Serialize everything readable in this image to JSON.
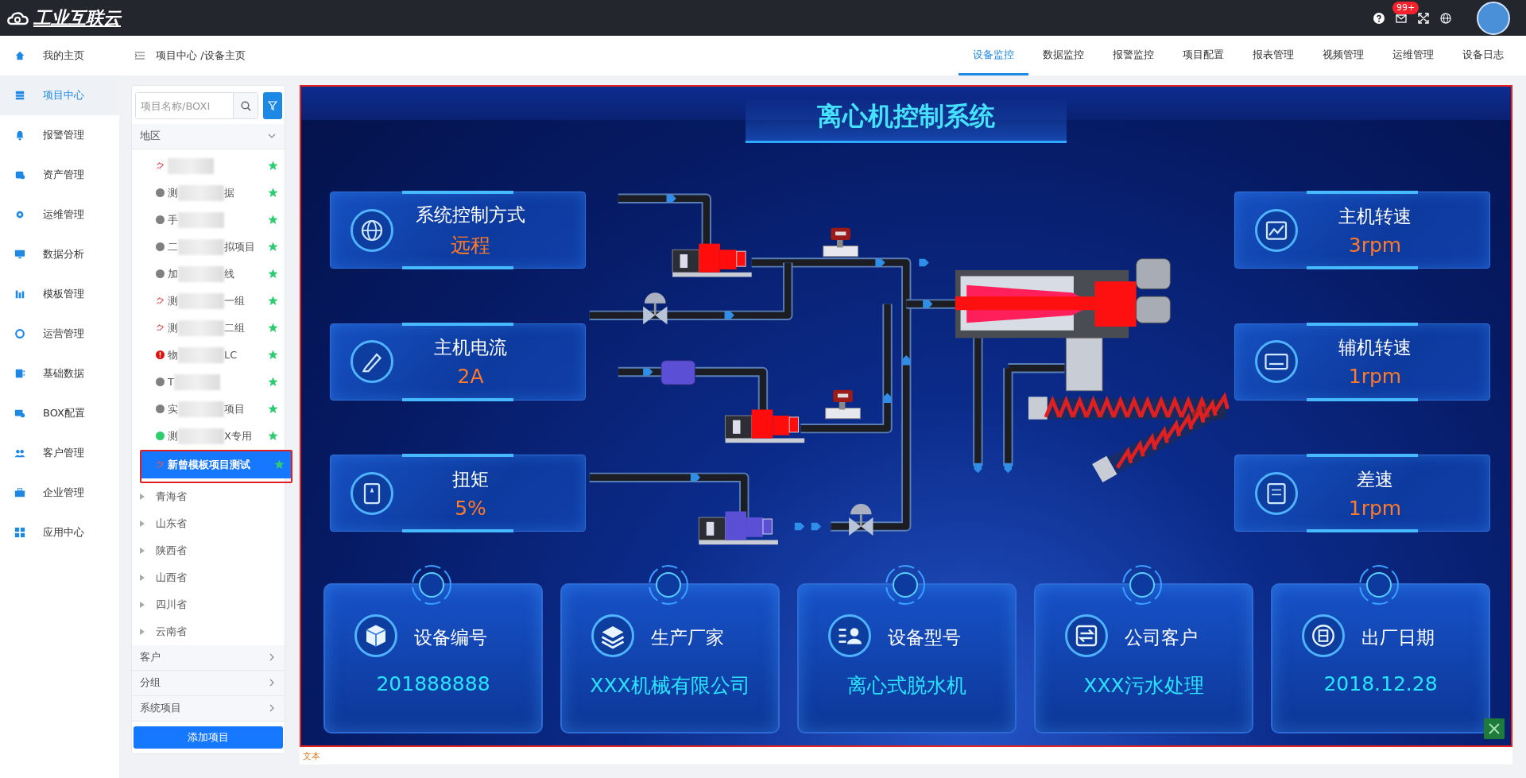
{
  "header": {
    "logo": "工业互联云",
    "notification_badge": "99+"
  },
  "nav": [
    {
      "label": "我的主页",
      "selected": false
    },
    {
      "label": "项目中心",
      "selected": true
    },
    {
      "label": "报警管理",
      "selected": false
    },
    {
      "label": "资产管理",
      "selected": false
    },
    {
      "label": "运维管理",
      "selected": false
    },
    {
      "label": "数据分析",
      "selected": false
    },
    {
      "label": "模板管理",
      "selected": false
    },
    {
      "label": "运营管理",
      "selected": false
    },
    {
      "label": "基础数据",
      "selected": false
    },
    {
      "label": "BOX配置",
      "selected": false
    },
    {
      "label": "客户管理",
      "selected": false
    },
    {
      "label": "企业管理",
      "selected": false
    },
    {
      "label": "应用中心",
      "selected": false
    }
  ],
  "breadcrumb": "项目中心 /设备主页",
  "tabs": [
    {
      "label": "设备监控",
      "selected": true
    },
    {
      "label": "数据监控",
      "selected": false
    },
    {
      "label": "报警监控",
      "selected": false
    },
    {
      "label": "项目配置",
      "selected": false
    },
    {
      "label": "报表管理",
      "selected": false
    },
    {
      "label": "视频管理",
      "selected": false
    },
    {
      "label": "运维管理",
      "selected": false
    },
    {
      "label": "设备日志",
      "selected": false
    }
  ],
  "tree": {
    "search": {
      "placeholder": "项目名称/BOXI"
    },
    "region": {
      "label": "地区",
      "expanded": true
    },
    "projects": [
      {
        "kind": "offline",
        "starred": true,
        "selected": false
      },
      {
        "kind": "idle",
        "text_start": "测",
        "text_end": "据",
        "starred": true,
        "selected": false
      },
      {
        "kind": "idle",
        "text_start": "手",
        "starred": true,
        "selected": false
      },
      {
        "kind": "idle",
        "text_start": "二",
        "text_end": "拟项目",
        "starred": true,
        "selected": false
      },
      {
        "kind": "idle",
        "text_start": "加",
        "text_end": "线",
        "starred": true,
        "selected": false
      },
      {
        "kind": "offline",
        "text_start": "测",
        "text_end": "一组",
        "starred": true,
        "selected": false
      },
      {
        "kind": "offline",
        "text_start": "测",
        "text_end": "二组",
        "starred": true,
        "selected": false
      },
      {
        "kind": "alarm",
        "text_start": "物",
        "text_end": "LC",
        "starred": true,
        "selected": false
      },
      {
        "kind": "idle",
        "text_start": "T",
        "starred": true,
        "selected": false
      },
      {
        "kind": "idle",
        "text_start": "实",
        "text_end": "项目",
        "starred": true,
        "selected": false
      },
      {
        "kind": "online",
        "text_start": "测",
        "text_end": "X专用",
        "starred": true,
        "selected": false
      },
      {
        "kind": "offline",
        "text_start": "新曾模板项目测试",
        "starred": true,
        "selected": true
      }
    ],
    "provinces": [
      {
        "label": "青海省",
        "expanded": false
      },
      {
        "label": "山东省",
        "expanded": false
      },
      {
        "label": "陕西省",
        "expanded": false
      },
      {
        "label": "山西省",
        "expanded": false
      },
      {
        "label": "四川省",
        "expanded": false
      },
      {
        "label": "云南省",
        "expanded": false
      }
    ],
    "sections": [
      {
        "label": "客户",
        "expanded": false
      },
      {
        "label": "分组",
        "expanded": false
      },
      {
        "label": "系统项目",
        "expanded": false
      }
    ],
    "add_button": "添加项目"
  },
  "dashboard": {
    "title": "离心机控制系统",
    "left_cards": [
      {
        "label": "系统控制方式",
        "value": "远程"
      },
      {
        "label": "主机电流",
        "value": "2A"
      },
      {
        "label": "扭矩",
        "value": "5%"
      }
    ],
    "right_cards": [
      {
        "label": "主机转速",
        "value": "3rpm"
      },
      {
        "label": "辅机转速",
        "value": "1rpm"
      },
      {
        "label": "差速",
        "value": "1rpm"
      }
    ],
    "bottom_cards": [
      {
        "label": "设备编号",
        "value": "201888888"
      },
      {
        "label": "生产厂家",
        "value": "XXX机械有限公司"
      },
      {
        "label": "设备型号",
        "value": "离心式脱水机"
      },
      {
        "label": "公司客户",
        "value": "XXX污水处理"
      },
      {
        "label": "出厂日期",
        "value": "2018.12.28"
      }
    ],
    "footer_text": "文本"
  }
}
